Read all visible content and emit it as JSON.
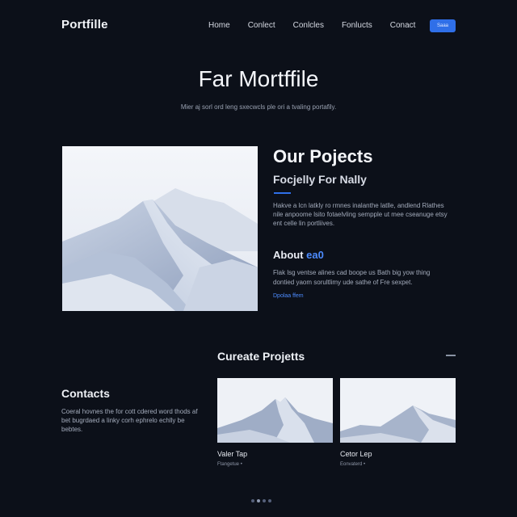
{
  "header": {
    "logo": "Portfille",
    "nav": [
      "Home",
      "Conlect",
      "Conlcles",
      "Fonlucts",
      "Conact"
    ],
    "cta_label": "Saaa"
  },
  "hero": {
    "title": "Far Mortffile",
    "subtitle": "Mier aj sorl ord leng sxecwcls ple ori a tvaling portafily."
  },
  "projects": {
    "title": "Our Pojects",
    "subtitle": "Focjelly For Nally",
    "body": "Hakve a lcn latkly ro rmnes inalanthe latlle, andlend Rlathes nile anpoome lsito fotaelvling sempple ut mee cseanuge etsy ent celle lin portliives.",
    "hero_image_icon": "mountain-image"
  },
  "about": {
    "title_main": "About ",
    "title_accent": "ea0",
    "body": "Flak lsg ventse alines cad boope us Bath big yow thing dontied yaom sorultlimy ude sathe of Fre sexpet.",
    "link": "Dpolaa ffem"
  },
  "curated": {
    "title": "Cureate Projetts",
    "cards": [
      {
        "title": "Valer Tap",
        "meta": "Ftangetue  •"
      },
      {
        "title": "Cetor Lep",
        "meta": "Eonvaterd  •"
      }
    ]
  },
  "contacts": {
    "title": "Contacts",
    "body": "Coeral hovnes the for cott cdered word thods af bet bugrdaed a linky corh ephrelo echlly be bebtes."
  },
  "pagination": {
    "count": 4,
    "active_index": 1
  },
  "colors": {
    "background": "#0c1019",
    "accent": "#2f6fe8",
    "text": "#e8ebf2",
    "muted": "#a3abbb"
  }
}
